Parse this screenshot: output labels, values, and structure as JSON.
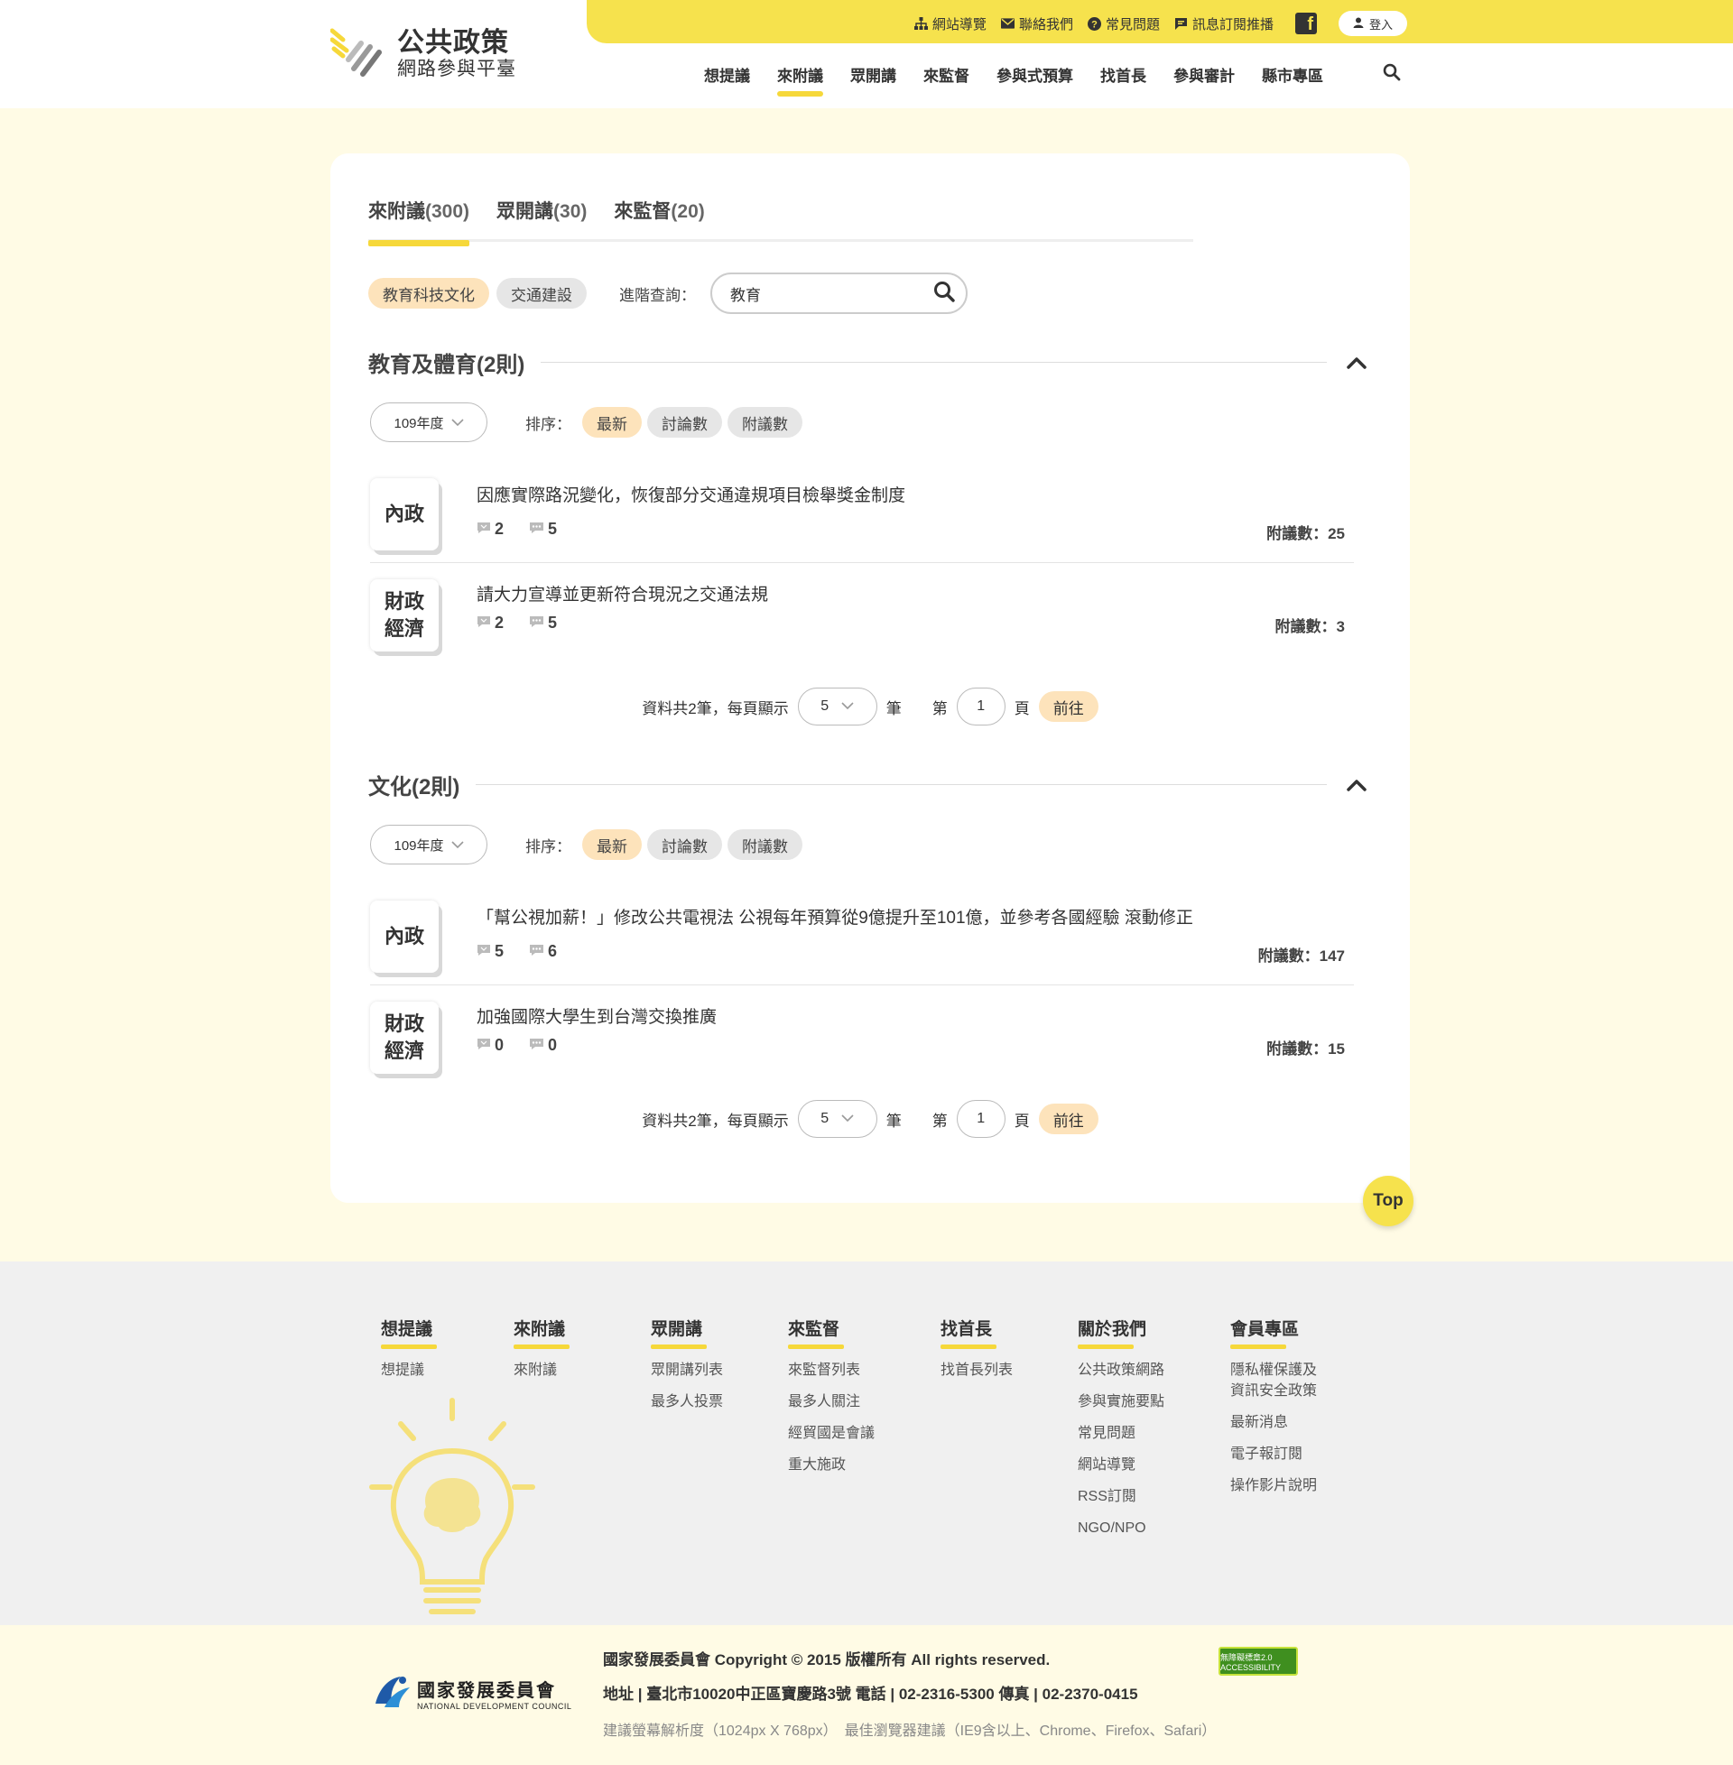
{
  "brand": {
    "name": "公共政策",
    "subtitle": "網路參與平臺",
    "accent": "#f6e24d"
  },
  "utility_nav": [
    {
      "label": "網站導覽",
      "icon": "sitemap-icon"
    },
    {
      "label": "聯絡我們",
      "icon": "mail-icon"
    },
    {
      "label": "常見問題",
      "icon": "question-icon"
    },
    {
      "label": "訊息訂閱推播",
      "icon": "chat-icon"
    }
  ],
  "login_label": "登入",
  "main_nav": [
    "想提議",
    "來附議",
    "眾開講",
    "來監督",
    "參與式預算",
    "找首長",
    "參與審計",
    "縣市專區"
  ],
  "main_nav_active": "來附議",
  "tabs": [
    {
      "label": "來附議",
      "count": "(300)"
    },
    {
      "label": "眾開講",
      "count": "(30)"
    },
    {
      "label": "來監督",
      "count": "(20)"
    }
  ],
  "filter_chips": [
    "教育科技文化",
    "交通建設"
  ],
  "advanced_search": {
    "label": "進階查詢：",
    "value": "教育"
  },
  "sort_label": "排序：",
  "sort_options": [
    "最新",
    "討論數",
    "附議數"
  ],
  "sections": [
    {
      "title": "教育及體育(2則)",
      "year": "109年度",
      "items": [
        {
          "category": "內政",
          "title": "因應實際路況變化，恢復部分交通違規項目檢舉獎金制度",
          "comments": "2",
          "messages": "5",
          "fuyi": "附議數：25"
        },
        {
          "category": "財政經濟",
          "title": "請大力宣導並更新符合現況之交通法規",
          "comments": "2",
          "messages": "5",
          "fuyi": "附議數：3"
        }
      ],
      "pager": {
        "summary": "資料共2筆，每頁顯示",
        "per_page": "5",
        "unit": "筆",
        "page_prefix": "第",
        "page": "1",
        "page_suffix": "頁",
        "go": "前往"
      }
    },
    {
      "title": "文化(2則)",
      "year": "109年度",
      "items": [
        {
          "category": "內政",
          "title": "「幫公視加薪！」修改公共電視法 公視每年預算從9億提升至101億，並參考各國經驗 滾動修正",
          "comments": "5",
          "messages": "6",
          "fuyi": "附議數：147"
        },
        {
          "category": "財政經濟",
          "title": "加強國際大學生到台灣交換推廣",
          "comments": "0",
          "messages": "0",
          "fuyi": "附議數：15"
        }
      ],
      "pager": {
        "summary": "資料共2筆，每頁顯示",
        "per_page": "5",
        "unit": "筆",
        "page_prefix": "第",
        "page": "1",
        "page_suffix": "頁",
        "go": "前往"
      }
    }
  ],
  "top_button": "Top",
  "footer_columns": [
    {
      "heading": "想提議",
      "links": [
        "想提議"
      ]
    },
    {
      "heading": "來附議",
      "links": [
        "來附議"
      ]
    },
    {
      "heading": "眾開講",
      "links": [
        "眾開講列表",
        "最多人投票"
      ]
    },
    {
      "heading": "來監督",
      "links": [
        "來監督列表",
        "最多人關注",
        "經貿國是會議",
        "重大施政"
      ]
    },
    {
      "heading": "找首長",
      "links": [
        "找首長列表"
      ]
    },
    {
      "heading": "關於我們",
      "links": [
        "公共政策網路",
        "參與實施要點",
        "常見問題",
        "網站導覽",
        "RSS訂閱",
        "NGO/NPO"
      ]
    },
    {
      "heading": "會員專區",
      "links": [
        "隱私權保護及資訊安全政策",
        "最新消息",
        "電子報訂閱",
        "操作影片說明"
      ]
    }
  ],
  "ndc_logo": {
    "zh": "國家發展委員會",
    "en": "NATIONAL DEVELOPMENT COUNCIL"
  },
  "copyright": "國家發展委員會 Copyright © 2015 版權所有 All rights reserved.",
  "address": "地址 | 臺北市10020中正區寶慶路3號 電話 | 02-2316-5300 傳真 | 02-2370-0415",
  "browser_advice": "建議螢幕解析度（1024px X 768px）　最佳瀏覽器建議（IE9含以上、Chrome、Firefox、Safari）",
  "accessibility_badge": "無障礙標章2.0 ACCESSIBILITY"
}
